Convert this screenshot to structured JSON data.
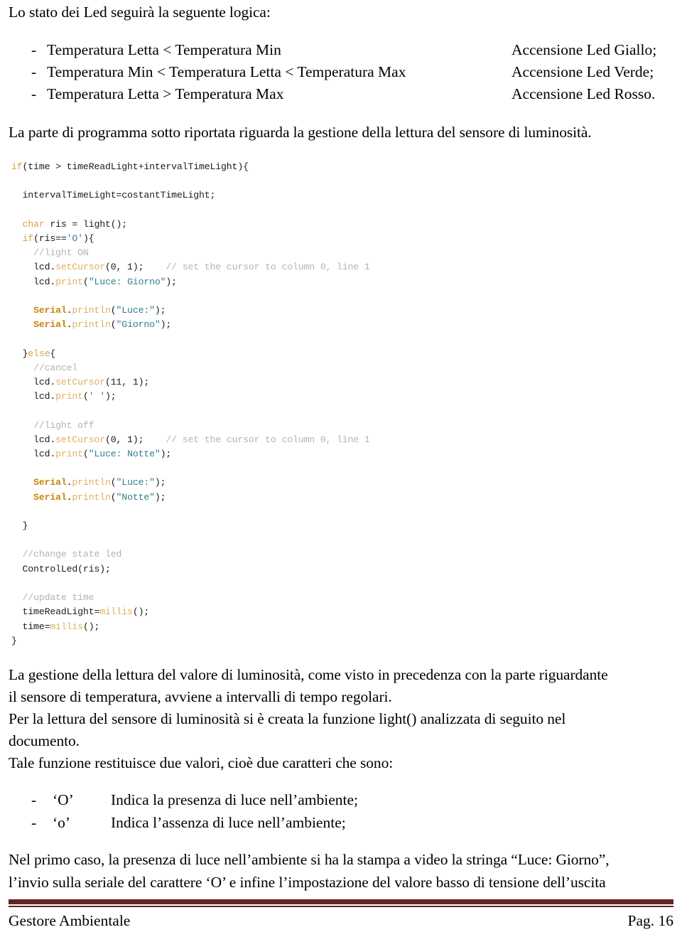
{
  "document": {
    "intro_heading": "Lo stato dei Led seguirà la seguente logica:",
    "after_list_paragraph": "La parte di programma sotto riportata riguarda la gestione della lettura del sensore di luminosità."
  },
  "led_logic": {
    "bullet": "-",
    "rows": [
      {
        "condition": "Temperatura Letta < Temperatura Min",
        "action": "Accensione Led Giallo;"
      },
      {
        "condition": "Temperatura Min < Temperatura Letta < Temperatura Max",
        "action": "Accensione Led Verde;"
      },
      {
        "condition": "Temperatura Letta > Temperatura Max",
        "action": "Accensione Led Rosso."
      }
    ]
  },
  "code": {
    "language": "arduino-c",
    "lines": [
      [
        {
          "t": "if",
          "c": "kw"
        },
        {
          "t": "(time > timeReadLight+intervalTimeLight){",
          "c": "pl"
        }
      ],
      [],
      [
        {
          "t": "  intervalTimeLight=costantTimeLight;",
          "c": "pl"
        }
      ],
      [],
      [
        {
          "t": "  ",
          "c": "pl"
        },
        {
          "t": "char",
          "c": "kw"
        },
        {
          "t": " ris = light();",
          "c": "pl"
        }
      ],
      [
        {
          "t": "  ",
          "c": "pl"
        },
        {
          "t": "if",
          "c": "kw"
        },
        {
          "t": "(ris==",
          "c": "pl"
        },
        {
          "t": "'O'",
          "c": "str"
        },
        {
          "t": "){",
          "c": "pl"
        }
      ],
      [
        {
          "t": "    ",
          "c": "pl"
        },
        {
          "t": "//light ON",
          "c": "cmt"
        }
      ],
      [
        {
          "t": "    lcd.",
          "c": "pl"
        },
        {
          "t": "setCursor",
          "c": "fn"
        },
        {
          "t": "(0, 1);    ",
          "c": "pl"
        },
        {
          "t": "// set the cursor to column 0, line 1",
          "c": "cmt"
        }
      ],
      [
        {
          "t": "    lcd.",
          "c": "pl"
        },
        {
          "t": "print",
          "c": "fn"
        },
        {
          "t": "(",
          "c": "pl"
        },
        {
          "t": "\"Luce: Giorno\"",
          "c": "str"
        },
        {
          "t": ");",
          "c": "pl"
        }
      ],
      [],
      [
        {
          "t": "    ",
          "c": "pl"
        },
        {
          "t": "Serial",
          "c": "obj"
        },
        {
          "t": ".",
          "c": "pl"
        },
        {
          "t": "println",
          "c": "fn"
        },
        {
          "t": "(",
          "c": "pl"
        },
        {
          "t": "\"Luce:\"",
          "c": "str"
        },
        {
          "t": ");",
          "c": "pl"
        }
      ],
      [
        {
          "t": "    ",
          "c": "pl"
        },
        {
          "t": "Serial",
          "c": "obj"
        },
        {
          "t": ".",
          "c": "pl"
        },
        {
          "t": "println",
          "c": "fn"
        },
        {
          "t": "(",
          "c": "pl"
        },
        {
          "t": "\"Giorno\"",
          "c": "str"
        },
        {
          "t": ");",
          "c": "pl"
        }
      ],
      [],
      [
        {
          "t": "  }",
          "c": "pl"
        },
        {
          "t": "else",
          "c": "kw"
        },
        {
          "t": "{",
          "c": "pl"
        }
      ],
      [
        {
          "t": "    ",
          "c": "pl"
        },
        {
          "t": "//cancel",
          "c": "cmt"
        }
      ],
      [
        {
          "t": "    lcd.",
          "c": "pl"
        },
        {
          "t": "setCursor",
          "c": "fn"
        },
        {
          "t": "(11, 1);",
          "c": "pl"
        }
      ],
      [
        {
          "t": "    lcd.",
          "c": "pl"
        },
        {
          "t": "print",
          "c": "fn"
        },
        {
          "t": "(",
          "c": "pl"
        },
        {
          "t": "' '",
          "c": "str"
        },
        {
          "t": ");",
          "c": "pl"
        }
      ],
      [],
      [
        {
          "t": "    ",
          "c": "pl"
        },
        {
          "t": "//light off",
          "c": "cmt"
        }
      ],
      [
        {
          "t": "    lcd.",
          "c": "pl"
        },
        {
          "t": "setCursor",
          "c": "fn"
        },
        {
          "t": "(0, 1);    ",
          "c": "pl"
        },
        {
          "t": "// set the cursor to column 0, line 1",
          "c": "cmt"
        }
      ],
      [
        {
          "t": "    lcd.",
          "c": "pl"
        },
        {
          "t": "print",
          "c": "fn"
        },
        {
          "t": "(",
          "c": "pl"
        },
        {
          "t": "\"Luce: Notte\"",
          "c": "str"
        },
        {
          "t": ");",
          "c": "pl"
        }
      ],
      [],
      [
        {
          "t": "    ",
          "c": "pl"
        },
        {
          "t": "Serial",
          "c": "obj"
        },
        {
          "t": ".",
          "c": "pl"
        },
        {
          "t": "println",
          "c": "fn"
        },
        {
          "t": "(",
          "c": "pl"
        },
        {
          "t": "\"Luce:\"",
          "c": "str"
        },
        {
          "t": ");",
          "c": "pl"
        }
      ],
      [
        {
          "t": "    ",
          "c": "pl"
        },
        {
          "t": "Serial",
          "c": "obj"
        },
        {
          "t": ".",
          "c": "pl"
        },
        {
          "t": "println",
          "c": "fn"
        },
        {
          "t": "(",
          "c": "pl"
        },
        {
          "t": "\"Notte\"",
          "c": "str"
        },
        {
          "t": ");",
          "c": "pl"
        }
      ],
      [],
      [
        {
          "t": "  }",
          "c": "pl"
        }
      ],
      [],
      [
        {
          "t": "  ",
          "c": "pl"
        },
        {
          "t": "//change state led",
          "c": "cmt"
        }
      ],
      [
        {
          "t": "  ControlLed(ris);",
          "c": "pl"
        }
      ],
      [],
      [
        {
          "t": "  ",
          "c": "pl"
        },
        {
          "t": "//update time",
          "c": "cmt"
        }
      ],
      [
        {
          "t": "  timeReadLight=",
          "c": "pl"
        },
        {
          "t": "millis",
          "c": "fn"
        },
        {
          "t": "();",
          "c": "pl"
        }
      ],
      [
        {
          "t": "  time=",
          "c": "pl"
        },
        {
          "t": "millis",
          "c": "fn"
        },
        {
          "t": "();",
          "c": "pl"
        }
      ],
      [
        {
          "t": "}",
          "c": "pl"
        }
      ]
    ]
  },
  "prose": {
    "paragraphs": [
      "La gestione della lettura del valore di luminosità, come visto in precedenza con la parte riguardante",
      "il sensore di temperatura, avviene a intervalli di tempo regolari.",
      "Per la lettura del sensore di luminosità si è creata la funzione light() analizzata di seguito nel",
      "documento.",
      "Tale funzione restituisce due valori, cioè due caratteri che sono:"
    ]
  },
  "char_list": {
    "bullet": "-",
    "rows": [
      {
        "symbol": "‘O’",
        "description": "Indica la presenza di luce nell’ambiente;"
      },
      {
        "symbol": "‘o’",
        "description": "Indica l’assenza di luce nell’ambiente;"
      }
    ]
  },
  "closing": {
    "paragraphs": [
      "Nel primo caso, la presenza di luce nell’ambiente si ha la stampa a video la stringa “Luce: Giorno”,",
      "l’invio sulla seriale del carattere ‘O’ e infine l’impostazione del valore basso di tensione dell’uscita"
    ]
  },
  "footer": {
    "left": "Gestore Ambientale",
    "right": "Pag. 16",
    "rule_color": "#632424"
  }
}
